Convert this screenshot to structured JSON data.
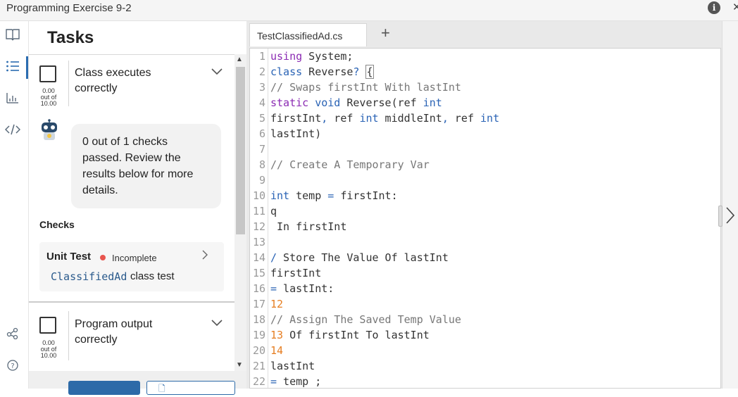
{
  "window": {
    "title": "Programming Exercise 9-2"
  },
  "rail": {
    "icons": [
      "book-icon",
      "list-icon",
      "chart-icon",
      "code-icon",
      "share-icon",
      "help-icon"
    ]
  },
  "tasks": {
    "heading": "Tasks",
    "items": [
      {
        "title": "Class executes correctly",
        "score": "0.00",
        "out_of": "out of",
        "max": "10.00",
        "feedback": "0 out of 1 checks passed. Review the results below for more details.",
        "checks_label": "Checks",
        "unit_test": {
          "title": "Unit Test",
          "status": "Incomplete",
          "status_color": "#e8554e",
          "code_word": "ClassifiedAd",
          "desc": "class test"
        }
      },
      {
        "title": "Program output correctly",
        "score": "0.00",
        "out_of": "out of",
        "max": "10.00"
      }
    ]
  },
  "editor": {
    "tab_label": "TestClassifiedAd.cs",
    "add_tab": "+",
    "lines": [
      {
        "n": "1",
        "text": "using System;"
      },
      {
        "n": "2",
        "text": "class Reverse? {"
      },
      {
        "n": "3",
        "text": "// Swaps firstInt With lastInt"
      },
      {
        "n": "4",
        "text": "static void Reverse(ref int"
      },
      {
        "n": "5",
        "text": "firstInt, ref int middleInt, ref int"
      },
      {
        "n": "6",
        "text": "lastInt)"
      },
      {
        "n": "7",
        "text": ""
      },
      {
        "n": "8",
        "text": "// Create A Temporary Var"
      },
      {
        "n": "9",
        "text": ""
      },
      {
        "n": "10",
        "text": "int temp = firstInt:"
      },
      {
        "n": "11",
        "text": "q"
      },
      {
        "n": "12",
        "text": " In firstInt"
      },
      {
        "n": "13",
        "text": ""
      },
      {
        "n": "14",
        "text": "/ Store The Value Of lastInt"
      },
      {
        "n": "15",
        "text": "firstInt"
      },
      {
        "n": "16",
        "text": "= lastInt:"
      },
      {
        "n": "17",
        "text": "12"
      },
      {
        "n": "18",
        "text": "// Assign The Saved Temp Value"
      },
      {
        "n": "19",
        "text": "13 Of firstInt To lastInt"
      },
      {
        "n": "20",
        "text": "14"
      },
      {
        "n": "21",
        "text": "lastInt"
      },
      {
        "n": "22",
        "text": "= temp ;"
      }
    ]
  },
  "colors": {
    "accent": "#2d6aa8",
    "incomplete": "#e8554e"
  }
}
